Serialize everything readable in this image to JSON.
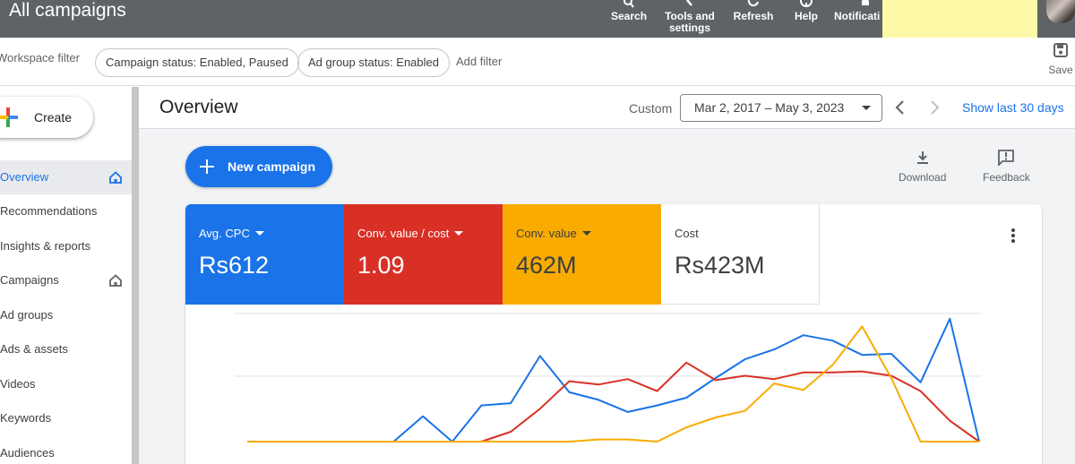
{
  "header": {
    "title": "All campaigns",
    "tools": [
      {
        "label": "Search",
        "icon": "search-icon"
      },
      {
        "label": "Tools and settings",
        "icon": "wrench-icon"
      },
      {
        "label": "Refresh",
        "icon": "refresh-icon"
      },
      {
        "label": "Help",
        "icon": "help-icon"
      },
      {
        "label": "Notificati",
        "icon": "bell-icon"
      }
    ],
    "colors": {
      "bar": "#5f6368",
      "promo": "#fdf8a6"
    }
  },
  "filters": {
    "workspace_label": "Workspace filter",
    "chips": [
      "Campaign status: Enabled, Paused",
      "Ad group status: Enabled"
    ],
    "add_filter": "Add filter",
    "save_label": "Save"
  },
  "sidebar": {
    "create_label": "Create",
    "items": [
      {
        "label": "Overview",
        "active": true,
        "home": true
      },
      {
        "label": "Recommendations",
        "active": false,
        "home": false
      },
      {
        "label": "Insights & reports",
        "active": false,
        "home": false
      },
      {
        "label": "Campaigns",
        "active": false,
        "home": true
      },
      {
        "label": "Ad groups",
        "active": false,
        "home": false
      },
      {
        "label": "Ads & assets",
        "active": false,
        "home": false
      },
      {
        "label": "Videos",
        "active": false,
        "home": false
      },
      {
        "label": "Keywords",
        "active": false,
        "home": false
      },
      {
        "label": "Audiences",
        "active": false,
        "home": false
      }
    ]
  },
  "main": {
    "title": "Overview",
    "date_mode": "Custom",
    "date_range": "Mar 2, 2017 – May 3, 2023",
    "show_last": "Show last 30 days",
    "new_campaign": "New campaign",
    "download": "Download",
    "feedback": "Feedback"
  },
  "metrics": [
    {
      "label": "Avg. CPC",
      "value": "Rs612",
      "color": "#1a73e8",
      "dropdown": true
    },
    {
      "label": "Conv. value / cost",
      "value": "1.09",
      "color": "#d93025",
      "dropdown": true
    },
    {
      "label": "Conv. value",
      "value": "462M",
      "color": "#f9ab00",
      "dropdown": true
    },
    {
      "label": "Cost",
      "value": "Rs423M",
      "color": "#ffffff",
      "dropdown": false
    }
  ],
  "chart_data": {
    "type": "line",
    "title": "",
    "grid": true,
    "x": [
      0,
      1,
      2,
      3,
      4,
      5,
      6,
      7,
      8,
      9,
      10,
      11,
      12,
      13,
      14,
      15,
      16,
      17,
      18,
      19,
      20,
      21,
      22,
      23,
      24,
      25
    ],
    "series": [
      {
        "name": "Avg. CPC",
        "color": "#1a73e8",
        "values": [
          0,
          0,
          0,
          0,
          0,
          0,
          0.23,
          0,
          0.33,
          0.35,
          0.78,
          0.45,
          0.38,
          0.27,
          0.33,
          0.4,
          0.58,
          0.75,
          0.84,
          0.97,
          0.92,
          0.79,
          0.8,
          0.54,
          1.12,
          0
        ]
      },
      {
        "name": "Conv. value / cost",
        "color": "#d93025",
        "values": [
          0,
          0,
          0,
          0,
          0,
          0,
          0,
          0,
          0,
          0.09,
          0.3,
          0.55,
          0.52,
          0.57,
          0.46,
          0.72,
          0.56,
          0.6,
          0.57,
          0.63,
          0.63,
          0.64,
          0.6,
          0.46,
          0.19,
          0
        ]
      },
      {
        "name": "Conv. value",
        "color": "#f9ab00",
        "values": [
          0,
          0,
          0,
          0,
          0,
          0,
          0,
          0,
          0,
          0,
          0,
          0,
          0.02,
          0.02,
          0,
          0.13,
          0.22,
          0.28,
          0.53,
          0.47,
          0.7,
          1.05,
          0.58,
          0,
          0,
          0
        ]
      }
    ]
  }
}
